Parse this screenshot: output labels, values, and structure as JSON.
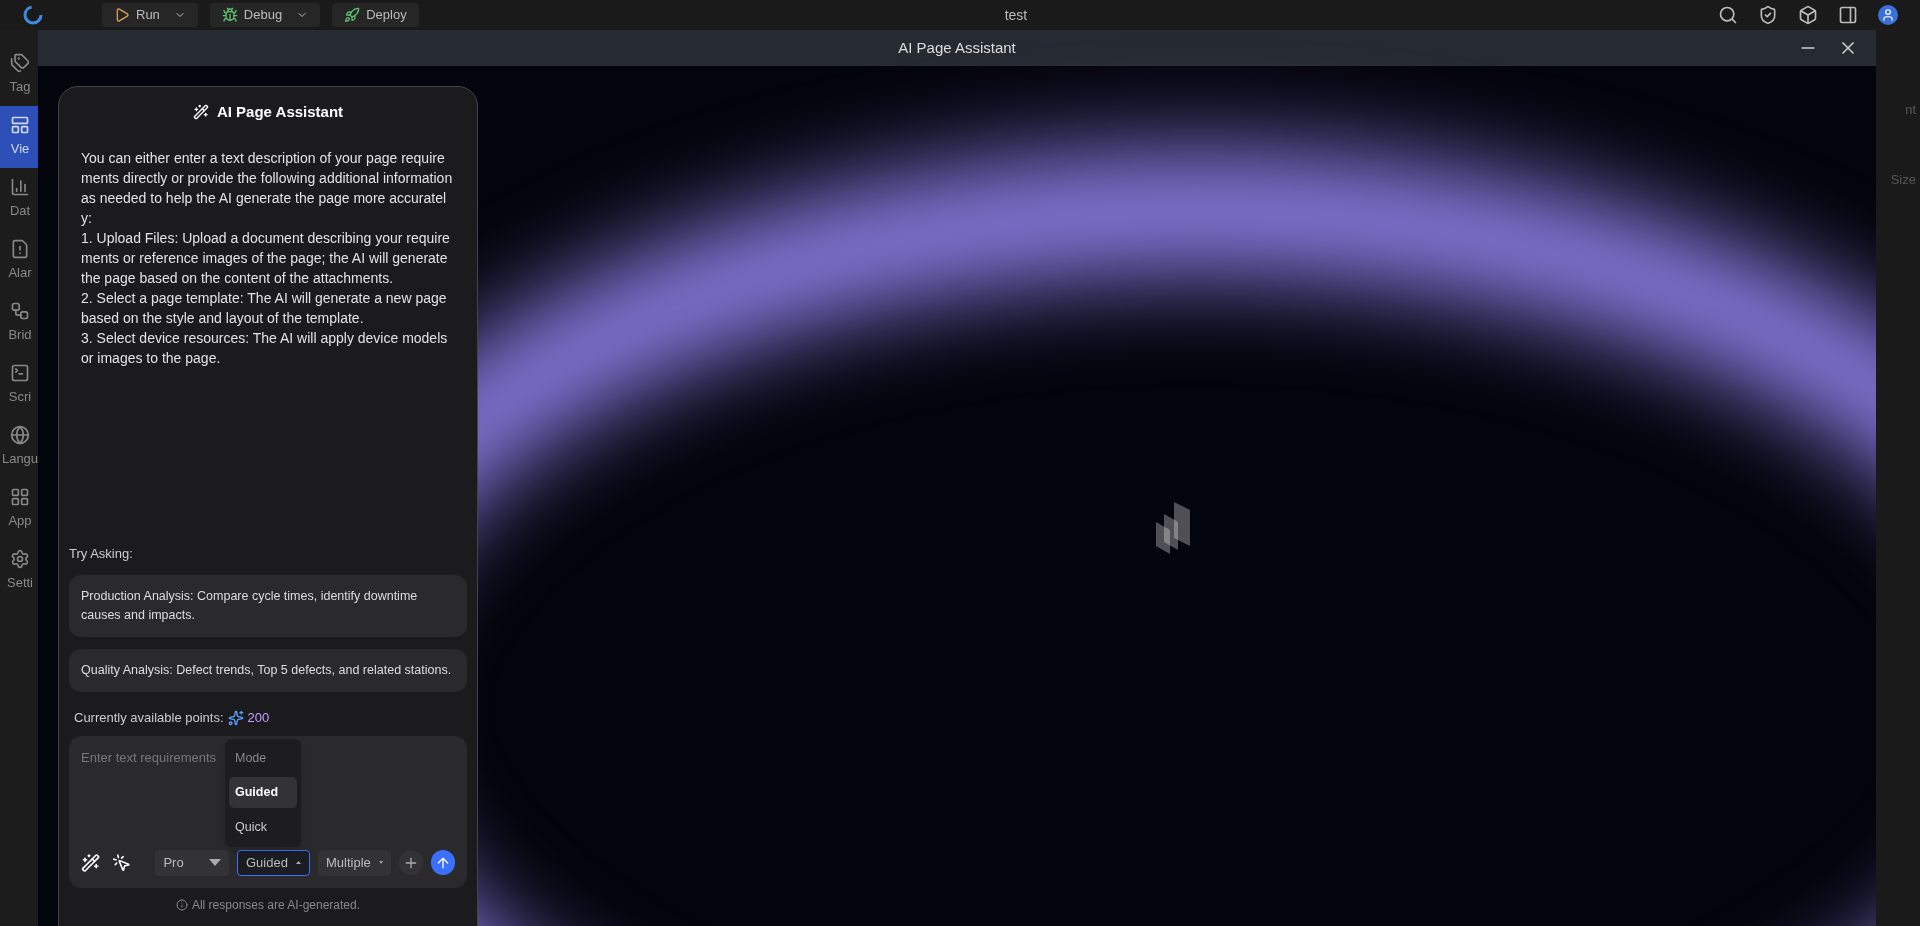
{
  "top_bar": {
    "buttons": [
      {
        "label": "Run",
        "kind": "run"
      },
      {
        "label": "Debug",
        "kind": "debug"
      },
      {
        "label": "Deploy",
        "kind": "deploy"
      }
    ],
    "project": "test"
  },
  "sidebar": {
    "items": [
      {
        "label": "Tag",
        "selected": false
      },
      {
        "label": "Vie",
        "selected": true
      },
      {
        "label": "Dat",
        "selected": false
      },
      {
        "label": "Alar",
        "selected": false
      },
      {
        "label": "Brid",
        "selected": false
      },
      {
        "label": "Scri",
        "selected": false
      },
      {
        "label": "Langu",
        "selected": false
      },
      {
        "label": "App",
        "selected": false
      },
      {
        "label": "Setti",
        "selected": false
      }
    ]
  },
  "right_panel": {
    "texts": [
      "nt",
      "Size"
    ]
  },
  "dialog": {
    "title": "AI Page Assistant"
  },
  "assistant": {
    "title": "AI Page Assistant",
    "intro": [
      "You can either enter a text description of your page requirements directly or provide the following additional information as needed to help the AI generate the page more accurately:",
      "1. Upload Files: Upload a document describing your requirements or reference images of the page; the AI will generate the page based on the content of the attachments.",
      "2. Select a page template: The AI will generate a new page based on the style and layout of the template.",
      "3. Select device resources: The AI will apply device models or images to the page."
    ],
    "try_label": "Try Asking:",
    "suggestions": [
      "Production Analysis: Compare cycle times, identify downtime causes and impacts.",
      "Quality Analysis: Defect trends, Top 5 defects, and related stations."
    ],
    "points_label": "Currently available points:",
    "points": "200",
    "input": {
      "placeholder": "Enter text requirements"
    },
    "selects": [
      {
        "value": "Pro",
        "open": false
      },
      {
        "value": "Guided",
        "open": true
      },
      {
        "value": "Multiple",
        "open": false
      }
    ],
    "menu": {
      "title": "Mode",
      "options": [
        {
          "label": "Guided",
          "selected": true
        },
        {
          "label": "Quick",
          "selected": false
        }
      ]
    },
    "disclaimer": "All responses are AI-generated."
  }
}
